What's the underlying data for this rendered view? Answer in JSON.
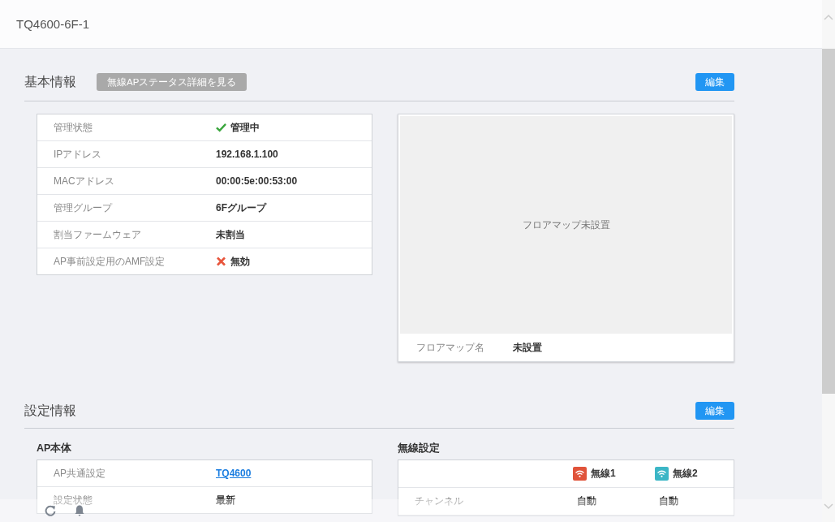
{
  "header": {
    "title": "TQ4600-6F-1"
  },
  "basic_info": {
    "title": "基本情報",
    "status_button": "無線APステータス詳細を見る",
    "edit_button": "編集",
    "rows": [
      {
        "label": "管理状態",
        "value": "管理中",
        "kind": "check"
      },
      {
        "label": "IPアドレス",
        "value": "192.168.1.100",
        "kind": "text"
      },
      {
        "label": "MACアドレス",
        "value": "00:00:5e:00:53:00",
        "kind": "text"
      },
      {
        "label": "管理グループ",
        "value": "6Fグループ",
        "kind": "text"
      },
      {
        "label": "割当ファームウェア",
        "value": "未割当",
        "kind": "text"
      },
      {
        "label": "AP事前設定用のAMF設定",
        "value": "無効",
        "kind": "cross"
      }
    ],
    "floor_map": {
      "empty_text": "フロアマップ未設置",
      "name_label": "フロアマップ名",
      "name_value": "未設置"
    }
  },
  "settings_info": {
    "title": "設定情報",
    "edit_button": "編集",
    "ap_body": {
      "title": "AP本体",
      "rows": [
        {
          "label": "AP共通設定",
          "value": "TQ4600",
          "kind": "link"
        },
        {
          "label": "設定状態",
          "value": "最新",
          "kind": "text"
        }
      ]
    },
    "wireless": {
      "title": "無線設定",
      "radios": [
        {
          "name": "無線1",
          "color": "#e0533a"
        },
        {
          "name": "無線2",
          "color": "#3bb6c6"
        }
      ],
      "rows": [
        {
          "label": "チャンネル",
          "values": [
            "自動",
            "自動"
          ]
        }
      ]
    }
  }
}
